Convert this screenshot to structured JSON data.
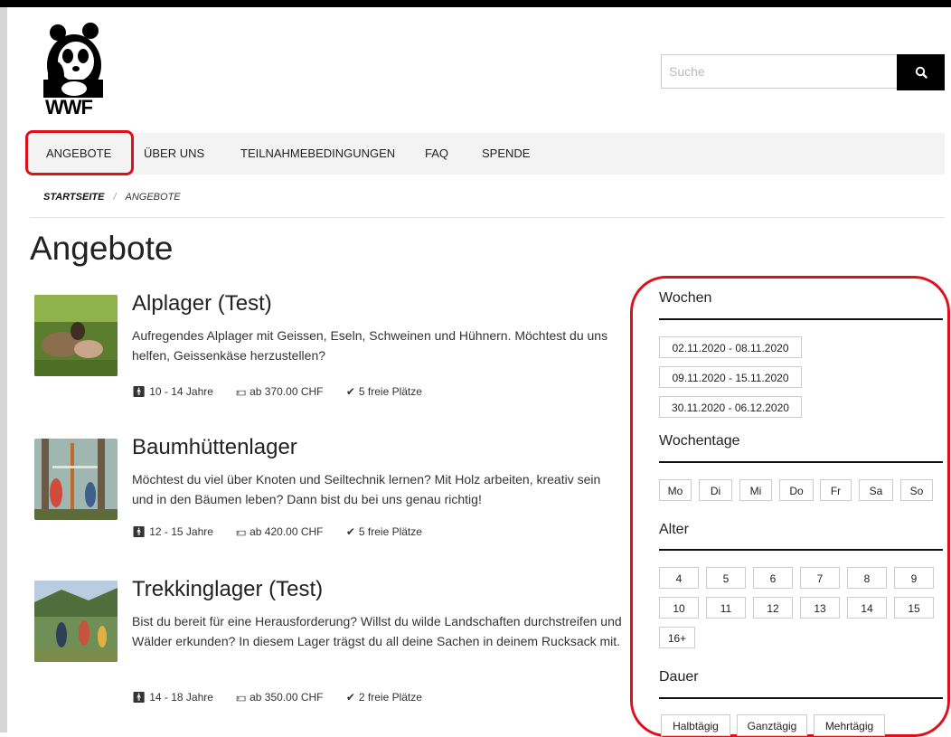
{
  "logo": {
    "text": "WWF",
    "icon": "panda-icon"
  },
  "search": {
    "placeholder": "Suche",
    "icon": "search-icon"
  },
  "nav": {
    "items": [
      "ANGEBOTE",
      "ÜBER UNS",
      "TEILNAHMEBEDINGUNGEN",
      "FAQ",
      "SPENDE"
    ],
    "active": "ANGEBOTE"
  },
  "breadcrumb": {
    "home": "STARTSEITE",
    "separator": "/",
    "current": "ANGEBOTE"
  },
  "page_title": "Angebote",
  "offers": [
    {
      "title": "Alplager (Test)",
      "description": "Aufregendes Alplager mit Geissen, Eseln, Schweinen und Hühnern. Möchtest du uns helfen, Geissenkäse herzustellen?",
      "age": "10 - 14 Jahre",
      "price": "ab 370.00 CHF",
      "spots": "5 freie Plätze"
    },
    {
      "title": "Baumhüttenlager",
      "description": "Möchtest du viel über Knoten und Seiltechnik lernen? Mit Holz arbeiten, kreativ sein und in den Bäumen leben? Dann bist du bei uns genau richtig!",
      "age": "12 - 15 Jahre",
      "price": "ab 420.00 CHF",
      "spots": "5 freie Plätze"
    },
    {
      "title": "Trekkinglager (Test)",
      "description": "Bist du bereit für eine Herausforderung? Willst du wilde Landschaften durchstreifen und Wälder erkunden? In diesem Lager trägst du all deine Sachen in deinem Rucksack mit.",
      "age": "14 - 18 Jahre",
      "price": "ab 350.00 CHF",
      "spots": "2 freie Plätze"
    }
  ],
  "filters": {
    "weeks": {
      "heading": "Wochen",
      "options": [
        "02.11.2020 - 08.11.2020",
        "09.11.2020 - 15.11.2020",
        "30.11.2020 - 06.12.2020"
      ]
    },
    "weekdays": {
      "heading": "Wochentage",
      "options": [
        "Mo",
        "Di",
        "Mi",
        "Do",
        "Fr",
        "Sa",
        "So"
      ]
    },
    "age": {
      "heading": "Alter",
      "options": [
        "4",
        "5",
        "6",
        "7",
        "8",
        "9",
        "10",
        "11",
        "12",
        "13",
        "14",
        "15",
        "16+"
      ]
    },
    "duration": {
      "heading": "Dauer",
      "options": [
        "Halbtägig",
        "Ganztägig",
        "Mehrtägig"
      ]
    }
  },
  "colors": {
    "highlight": "#e0101b",
    "nav_bg": "#f2f3f2",
    "search_button": "#000000"
  }
}
